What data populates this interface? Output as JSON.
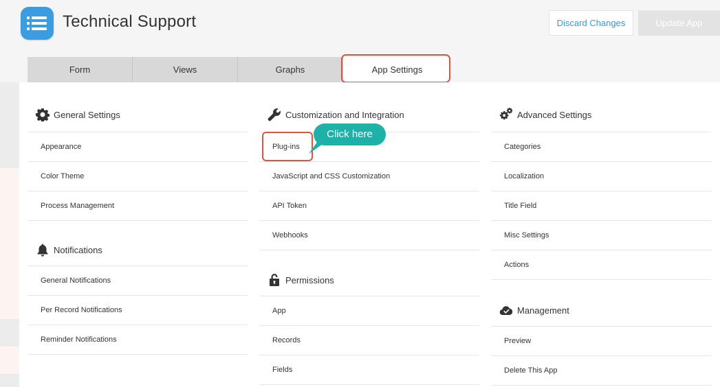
{
  "header": {
    "app_title": "Technical Support",
    "discard_label": "Discard Changes",
    "update_label": "Update App"
  },
  "tabs": [
    {
      "label": "Form",
      "active": false
    },
    {
      "label": "Views",
      "active": false
    },
    {
      "label": "Graphs",
      "active": false
    },
    {
      "label": "App Settings",
      "active": true
    }
  ],
  "callout": {
    "text": "Click here"
  },
  "columns": {
    "general": {
      "title": "General Settings",
      "icon": "gear-icon",
      "items": [
        "Appearance",
        "Color Theme",
        "Process Management"
      ]
    },
    "notifications": {
      "title": "Notifications",
      "icon": "bell-icon",
      "items": [
        "General Notifications",
        "Per Record Notifications",
        "Reminder Notifications"
      ]
    },
    "customization": {
      "title": "Customization and Integration",
      "icon": "wrench-icon",
      "items": [
        "Plug-ins",
        "JavaScript and CSS Customization",
        "API Token",
        "Webhooks"
      ]
    },
    "permissions": {
      "title": "Permissions",
      "icon": "lock-icon",
      "items": [
        "App",
        "Records",
        "Fields"
      ]
    },
    "advanced": {
      "title": "Advanced Settings",
      "icon": "gears-icon",
      "items": [
        "Categories",
        "Localization",
        "Title Field",
        "Misc Settings",
        "Actions"
      ]
    },
    "management": {
      "title": "Management",
      "icon": "cloud-check-icon",
      "items": [
        "Preview",
        "Delete This App"
      ]
    }
  },
  "colors": {
    "accent_blue": "#3498db",
    "callout_teal": "#1db1a8",
    "highlight_red": "#e0533f",
    "app_icon_blue": "#3b9ddf"
  }
}
